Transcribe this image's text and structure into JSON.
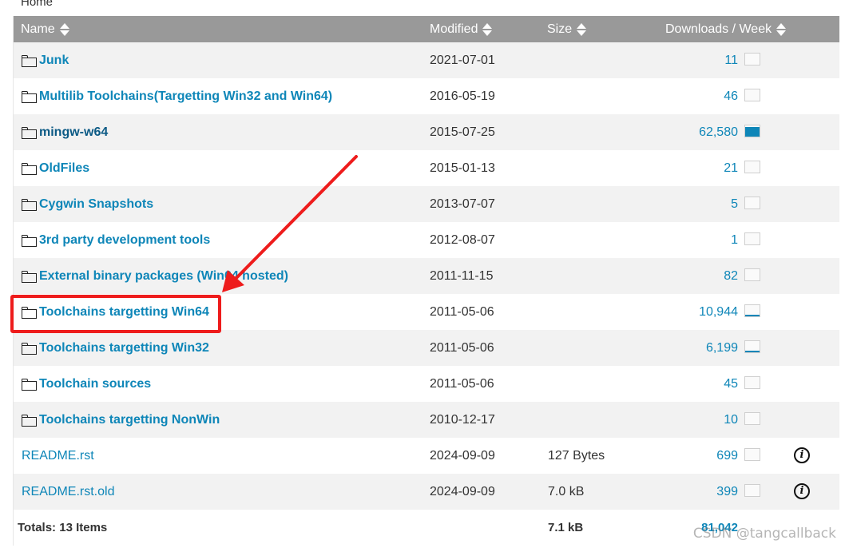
{
  "breadcrumb": "Home",
  "columns": {
    "name": "Name",
    "modified": "Modified",
    "size": "Size",
    "downloads": "Downloads / Week"
  },
  "rows": [
    {
      "name": "Junk",
      "modified": "2021-07-01",
      "size": "",
      "downloads": "11",
      "activity": 0.0,
      "type": "folder"
    },
    {
      "name": "Multilib Toolchains(Targetting Win32 and Win64)",
      "modified": "2016-05-19",
      "size": "",
      "downloads": "46",
      "activity": 0.0,
      "type": "folder"
    },
    {
      "name": "mingw-w64",
      "modified": "2015-07-25",
      "size": "",
      "downloads": "62,580",
      "activity": 0.85,
      "type": "folder"
    },
    {
      "name": "OldFiles",
      "modified": "2015-01-13",
      "size": "",
      "downloads": "21",
      "activity": 0.0,
      "type": "folder"
    },
    {
      "name": "Cygwin Snapshots",
      "modified": "2013-07-07",
      "size": "",
      "downloads": "5",
      "activity": 0.0,
      "type": "folder"
    },
    {
      "name": "3rd party development tools",
      "modified": "2012-08-07",
      "size": "",
      "downloads": "1",
      "activity": 0.0,
      "type": "folder"
    },
    {
      "name": "External binary packages (Win64 hosted)",
      "modified": "2011-11-15",
      "size": "",
      "downloads": "82",
      "activity": 0.0,
      "type": "folder"
    },
    {
      "name": "Toolchains targetting Win64",
      "modified": "2011-05-06",
      "size": "",
      "downloads": "10,944",
      "activity": 0.12,
      "type": "folder"
    },
    {
      "name": "Toolchains targetting Win32",
      "modified": "2011-05-06",
      "size": "",
      "downloads": "6,199",
      "activity": 0.08,
      "type": "folder"
    },
    {
      "name": "Toolchain sources",
      "modified": "2011-05-06",
      "size": "",
      "downloads": "45",
      "activity": 0.0,
      "type": "folder"
    },
    {
      "name": "Toolchains targetting NonWin",
      "modified": "2010-12-17",
      "size": "",
      "downloads": "10",
      "activity": 0.0,
      "type": "folder"
    },
    {
      "name": "README.rst",
      "modified": "2024-09-09",
      "size": "127 Bytes",
      "downloads": "699",
      "activity": 0.0,
      "type": "file"
    },
    {
      "name": "README.rst.old",
      "modified": "2024-09-09",
      "size": "7.0 kB",
      "downloads": "399",
      "activity": 0.0,
      "type": "file"
    }
  ],
  "totals": {
    "label": "Totals: 13 Items",
    "size": "7.1 kB",
    "downloads": "81,042"
  },
  "watermark": "CSDN @tangcallback",
  "colors": {
    "header_bg": "#999999",
    "link": "#0e86b8",
    "highlight": "#ee1c1c"
  }
}
